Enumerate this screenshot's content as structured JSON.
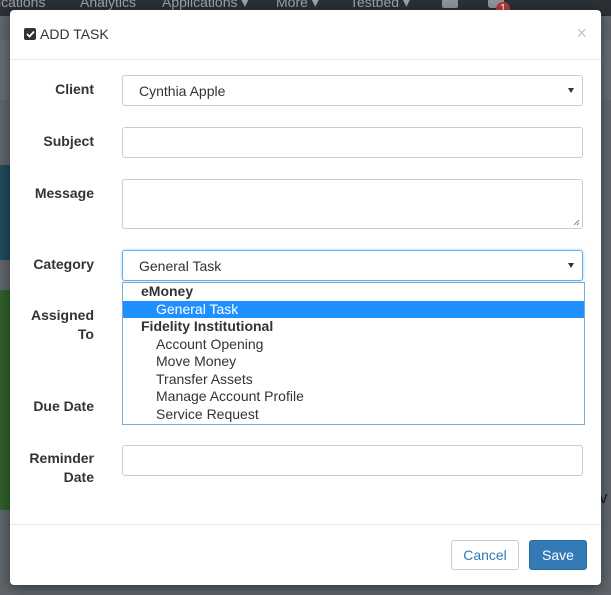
{
  "background": {
    "nav": [
      "ications",
      "Analytics",
      "Applications ▾",
      "More ▾",
      "Testbed ▾"
    ],
    "notification_count": "1",
    "edge_text": "v"
  },
  "modal": {
    "title": "ADD TASK",
    "close": "×",
    "fields": {
      "client": {
        "label": "Client",
        "value": "Cynthia Apple"
      },
      "subject": {
        "label": "Subject",
        "value": ""
      },
      "message": {
        "label": "Message",
        "value": ""
      },
      "category": {
        "label": "Category",
        "value": "General Task"
      },
      "assigned_to": {
        "label_line1": "Assigned",
        "label_line2": "To"
      },
      "due_date": {
        "label": "Due Date"
      },
      "reminder_date": {
        "label_line1": "Reminder",
        "label_line2": "Date",
        "value": ""
      }
    },
    "category_options": [
      {
        "text": "eMoney",
        "group": true
      },
      {
        "text": "General Task",
        "group": false,
        "selected": true
      },
      {
        "text": "Fidelity Institutional",
        "group": true
      },
      {
        "text": "Account Opening",
        "group": false
      },
      {
        "text": "Move Money",
        "group": false
      },
      {
        "text": "Transfer Assets",
        "group": false
      },
      {
        "text": "Manage Account Profile",
        "group": false
      },
      {
        "text": "Service Request",
        "group": false
      }
    ],
    "footer": {
      "cancel": "Cancel",
      "save": "Save"
    }
  },
  "colors": {
    "primary": "#337ab7",
    "selected_option": "#1e90ff",
    "focus_border": "#66afe9"
  }
}
